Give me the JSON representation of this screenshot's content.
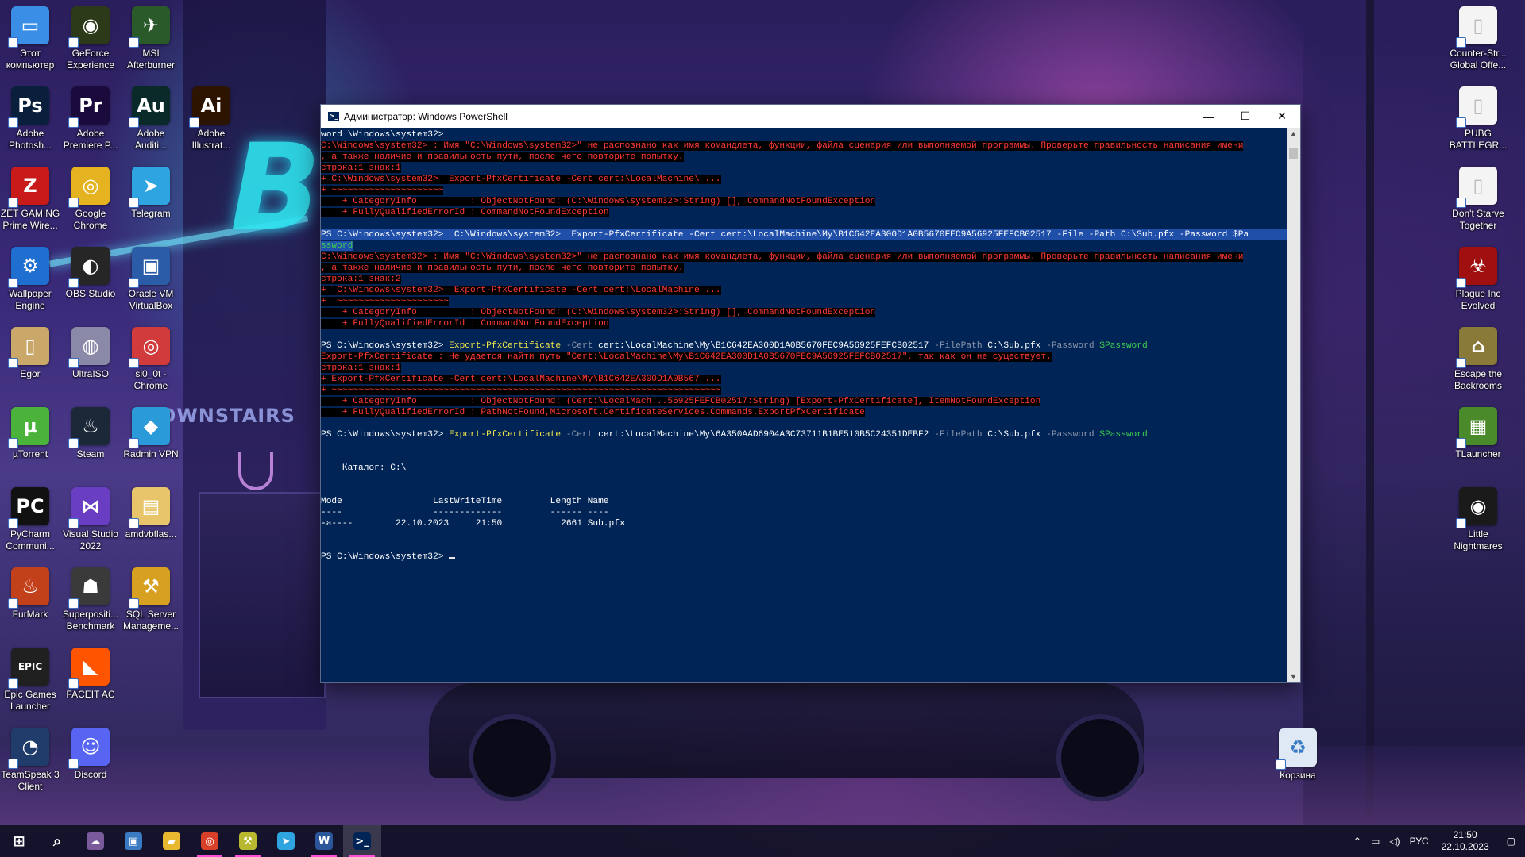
{
  "desktop_icons_left": [
    {
      "label": "Этот компьютер",
      "icon": "this-pc-icon",
      "glyph": "▭",
      "color": "#3a8ee6"
    },
    {
      "label": "GeForce Experience",
      "icon": "geforce-icon",
      "glyph": "◉",
      "color": "#2d3a1a"
    },
    {
      "label": "MSI Afterburner",
      "icon": "msi-afterburner-icon",
      "glyph": "✈",
      "color": "#2a5a2a"
    },
    {
      "label": "Adobe Photosh...",
      "icon": "photoshop-icon",
      "glyph": "Ps",
      "color": "#0a1f3c"
    },
    {
      "label": "Adobe Premiere P...",
      "icon": "premiere-icon",
      "glyph": "Pr",
      "color": "#1a0b3c"
    },
    {
      "label": "Adobe Auditi...",
      "icon": "audition-icon",
      "glyph": "Au",
      "color": "#0a2a2a"
    },
    {
      "label": "Adobe Illustrat...",
      "icon": "illustrator-icon",
      "glyph": "Ai",
      "color": "#2c1400"
    },
    {
      "label": "ZET GAMING Prime Wire...",
      "icon": "zet-gaming-icon",
      "glyph": "Z",
      "color": "#c91a1a"
    },
    {
      "label": "Google Chrome",
      "icon": "chrome-icon",
      "glyph": "◎",
      "color": "#e5b320"
    },
    {
      "label": "Telegram",
      "icon": "telegram-icon",
      "glyph": "➤",
      "color": "#2ea5e0"
    },
    {
      "label": "Wallpaper Engine",
      "icon": "wallpaper-engine-icon",
      "glyph": "⚙",
      "color": "#1f6fd1"
    },
    {
      "label": "OBS Studio",
      "icon": "obs-icon",
      "glyph": "◐",
      "color": "#262626"
    },
    {
      "label": "Oracle VM VirtualBox",
      "icon": "virtualbox-icon",
      "glyph": "▣",
      "color": "#2b5ca8"
    },
    {
      "label": "Egor",
      "icon": "folder-user-icon",
      "glyph": "▯",
      "color": "#c9a86a"
    },
    {
      "label": "UltraISO",
      "icon": "ultraiso-icon",
      "glyph": "◍",
      "color": "#8a8aa8"
    },
    {
      "label": "sl0_0t - Chrome",
      "icon": "chrome-profile-icon",
      "glyph": "◎",
      "color": "#d13b3b"
    },
    {
      "label": "µTorrent",
      "icon": "utorrent-icon",
      "glyph": "µ",
      "color": "#4bb33a"
    },
    {
      "label": "Steam",
      "icon": "steam-icon",
      "glyph": "♨",
      "color": "#1b2838"
    },
    {
      "label": "Radmin VPN",
      "icon": "radmin-vpn-icon",
      "glyph": "◆",
      "color": "#2a9ad8"
    },
    {
      "label": "PyCharm Communi...",
      "icon": "pycharm-icon",
      "glyph": "PC",
      "color": "#111111"
    },
    {
      "label": "Visual Studio 2022",
      "icon": "visual-studio-icon",
      "glyph": "⋈",
      "color": "#6a3ec2"
    },
    {
      "label": "amdvbflas...",
      "icon": "folder-icon",
      "glyph": "▤",
      "color": "#e8c46a"
    },
    {
      "label": "FurMark",
      "icon": "furmark-icon",
      "glyph": "♨",
      "color": "#c2401a"
    },
    {
      "label": "Superpositi... Benchmark",
      "icon": "superposition-icon",
      "glyph": "☗",
      "color": "#3a3a3a"
    },
    {
      "label": "SQL Server Manageme...",
      "icon": "sql-server-icon",
      "glyph": "⚒",
      "color": "#d8a020"
    },
    {
      "label": "Epic Games Launcher",
      "icon": "epic-games-icon",
      "glyph": "EPIC",
      "color": "#202020"
    },
    {
      "label": "FACEIT AC",
      "icon": "faceit-icon",
      "glyph": "◣",
      "color": "#ff5500"
    },
    {
      "label": "TeamSpeak 3 Client",
      "icon": "teamspeak-icon",
      "glyph": "◔",
      "color": "#1f3c6a"
    },
    {
      "label": "Discord",
      "icon": "discord-icon",
      "glyph": "☺",
      "color": "#5865f2"
    }
  ],
  "desktop_icons_right": [
    {
      "label": "Counter-Str... Global Offe...",
      "icon": "csgo-file-icon",
      "glyph": "▯",
      "color": "#f4f4f4"
    },
    {
      "label": "PUBG BATTLEGR...",
      "icon": "pubg-file-icon",
      "glyph": "▯",
      "color": "#f4f4f4"
    },
    {
      "label": "Don't Starve Together",
      "icon": "dst-file-icon",
      "glyph": "▯",
      "color": "#f4f4f4"
    },
    {
      "label": "Plague Inc Evolved",
      "icon": "plague-inc-icon",
      "glyph": "☣",
      "color": "#a01010"
    },
    {
      "label": "Escape the Backrooms",
      "icon": "escape-backrooms-icon",
      "glyph": "⌂",
      "color": "#8a7a3a"
    },
    {
      "label": "TLauncher",
      "icon": "tlauncher-icon",
      "glyph": "▦",
      "color": "#4a8a2a"
    },
    {
      "label": "Little Nightmares",
      "icon": "little-nightmares-icon",
      "glyph": "◉",
      "color": "#1a1a1a"
    }
  ],
  "recycle_bin": {
    "label": "Корзина",
    "icon": "recycle-bin-icon"
  },
  "powershell": {
    "title": "Администратор: Windows PowerShell",
    "lines": [
      {
        "k": "plain",
        "t": "word \\Windows\\system32>"
      },
      {
        "k": "err",
        "t": "C:\\Windows\\system32> : Имя \"C:\\Windows\\system32>\" не распознано как имя командлета, функции, файла сценария или выполняемой программы. Проверьте правильность написания имени"
      },
      {
        "k": "err",
        "t": ", а также наличие и правильность пути, после чего повторите попытку."
      },
      {
        "k": "err",
        "t": "строка:1 знак:1"
      },
      {
        "k": "err",
        "t": "+ C:\\Windows\\system32>  Export-PfxCertificate -Cert cert:\\LocalMachine\\ ..."
      },
      {
        "k": "err",
        "t": "+ ~~~~~~~~~~~~~~~~~~~~~"
      },
      {
        "k": "err",
        "t": "    + CategoryInfo          : ObjectNotFound: (C:\\Windows\\system32>:String) [], CommandNotFoundException"
      },
      {
        "k": "err",
        "t": "    + FullyQualifiedErrorId : CommandNotFoundException"
      },
      {
        "k": "blank",
        "t": ""
      },
      {
        "k": "cmd1",
        "t": "PS C:\\Windows\\system32>  C:\\Windows\\system32>  Export-PfxCertificate -Cert cert:\\LocalMachine\\My\\B1C642EA300D1A0B5670FEC9A56925FEFCB02517 -File -Path C:\\Sub.pfx -Password $Pa"
      },
      {
        "k": "sel",
        "t": "ssword"
      },
      {
        "k": "err",
        "t": "C:\\Windows\\system32> : Имя \"C:\\Windows\\system32>\" не распознано как имя командлета, функции, файла сценария или выполняемой программы. Проверьте правильность написания имени"
      },
      {
        "k": "err",
        "t": ", а также наличие и правильность пути, после чего повторите попытку."
      },
      {
        "k": "err",
        "t": "строка:1 знак:2"
      },
      {
        "k": "err",
        "t": "+  C:\\Windows\\system32>  Export-PfxCertificate -Cert cert:\\LocalMachine ..."
      },
      {
        "k": "err",
        "t": "+  ~~~~~~~~~~~~~~~~~~~~~"
      },
      {
        "k": "err",
        "t": "    + CategoryInfo          : ObjectNotFound: (C:\\Windows\\system32>:String) [], CommandNotFoundException"
      },
      {
        "k": "err",
        "t": "    + FullyQualifiedErrorId : CommandNotFoundException"
      },
      {
        "k": "blank",
        "t": ""
      },
      {
        "k": "cmd2",
        "prompt": "PS C:\\Windows\\system32> ",
        "cmdlet": "Export-PfxCertificate",
        "p1": " -Cert ",
        "a1": "cert:\\LocalMachine\\My\\B1C642EA300D1A0B5670FEC9A56925FEFCB02517",
        "p2": " -FilePath ",
        "a2": "C:\\Sub.pfx",
        "p3": " -Password ",
        "a3": "$Password"
      },
      {
        "k": "err",
        "t": "Export-PfxCertificate : Не удается найти путь \"Cert:\\LocalMachine\\My\\B1C642EA300D1A0B5670FEC9A56925FEFCB02517\", так как он не существует."
      },
      {
        "k": "err",
        "t": "строка:1 знак:1"
      },
      {
        "k": "err",
        "t": "+ Export-PfxCertificate -Cert cert:\\LocalMachine\\My\\B1C642EA300D1A0B567 ..."
      },
      {
        "k": "err",
        "t": "+ ~~~~~~~~~~~~~~~~~~~~~~~~~~~~~~~~~~~~~~~~~~~~~~~~~~~~~~~~~~~~~~~~~~~~~~~~~"
      },
      {
        "k": "err",
        "t": "    + CategoryInfo          : ObjectNotFound: (Cert:\\LocalMach...56925FEFCB02517:String) [Export-PfxCertificate], ItemNotFoundException"
      },
      {
        "k": "err",
        "t": "    + FullyQualifiedErrorId : PathNotFound,Microsoft.CertificateServices.Commands.ExportPfxCertificate"
      },
      {
        "k": "blank",
        "t": ""
      },
      {
        "k": "cmd2",
        "prompt": "PS C:\\Windows\\system32> ",
        "cmdlet": "Export-PfxCertificate",
        "p1": " -Cert ",
        "a1": "cert:\\LocalMachine\\My\\6A350AAD6904A3C73711B1BE510B5C24351DEBF2",
        "p2": " -FilePath ",
        "a2": "C:\\Sub.pfx",
        "p3": " -Password ",
        "a3": "$Password"
      },
      {
        "k": "blank",
        "t": ""
      },
      {
        "k": "blank",
        "t": ""
      },
      {
        "k": "plain",
        "t": "    Каталог: C:\\"
      },
      {
        "k": "blank",
        "t": ""
      },
      {
        "k": "blank",
        "t": ""
      },
      {
        "k": "plain",
        "t": "Mode                 LastWriteTime         Length Name"
      },
      {
        "k": "plain",
        "t": "----                 -------------         ------ ----"
      },
      {
        "k": "plain",
        "t": "-a----        22.10.2023     21:50           2661 Sub.pfx"
      },
      {
        "k": "blank",
        "t": ""
      },
      {
        "k": "blank",
        "t": ""
      },
      {
        "k": "prompt",
        "t": "PS C:\\Windows\\system32> "
      }
    ]
  },
  "taskbar": {
    "items": [
      {
        "name": "start-button",
        "icon": "windows-start-icon",
        "glyph": "⊞",
        "color": "transparent",
        "running": false
      },
      {
        "name": "search-button",
        "icon": "search-icon",
        "glyph": "⌕",
        "color": "transparent",
        "running": false
      },
      {
        "name": "taskbar-app-1",
        "icon": "app-avatar-icon",
        "glyph": "☁",
        "color": "#7a5a9a",
        "running": false
      },
      {
        "name": "taskbar-app-2",
        "icon": "control-panel-icon",
        "glyph": "▣",
        "color": "#3a7ac2",
        "running": false
      },
      {
        "name": "taskbar-explorer",
        "icon": "file-explorer-icon",
        "glyph": "▰",
        "color": "#e8b830",
        "running": false
      },
      {
        "name": "taskbar-chrome",
        "icon": "chrome-icon",
        "glyph": "◎",
        "color": "#d8402a",
        "running": true
      },
      {
        "name": "taskbar-app-3",
        "icon": "sql-tool-icon",
        "glyph": "⚒",
        "color": "#b8b830",
        "running": true
      },
      {
        "name": "taskbar-telegram",
        "icon": "telegram-icon",
        "glyph": "➤",
        "color": "#2ea5e0",
        "running": false
      },
      {
        "name": "taskbar-word",
        "icon": "word-icon",
        "glyph": "W",
        "color": "#2b579a",
        "running": true
      },
      {
        "name": "taskbar-powershell",
        "icon": "powershell-icon",
        "glyph": ">_",
        "color": "#012456",
        "running": true,
        "active": true
      }
    ],
    "language": "РУС",
    "time": "21:50",
    "date": "22.10.2023"
  }
}
